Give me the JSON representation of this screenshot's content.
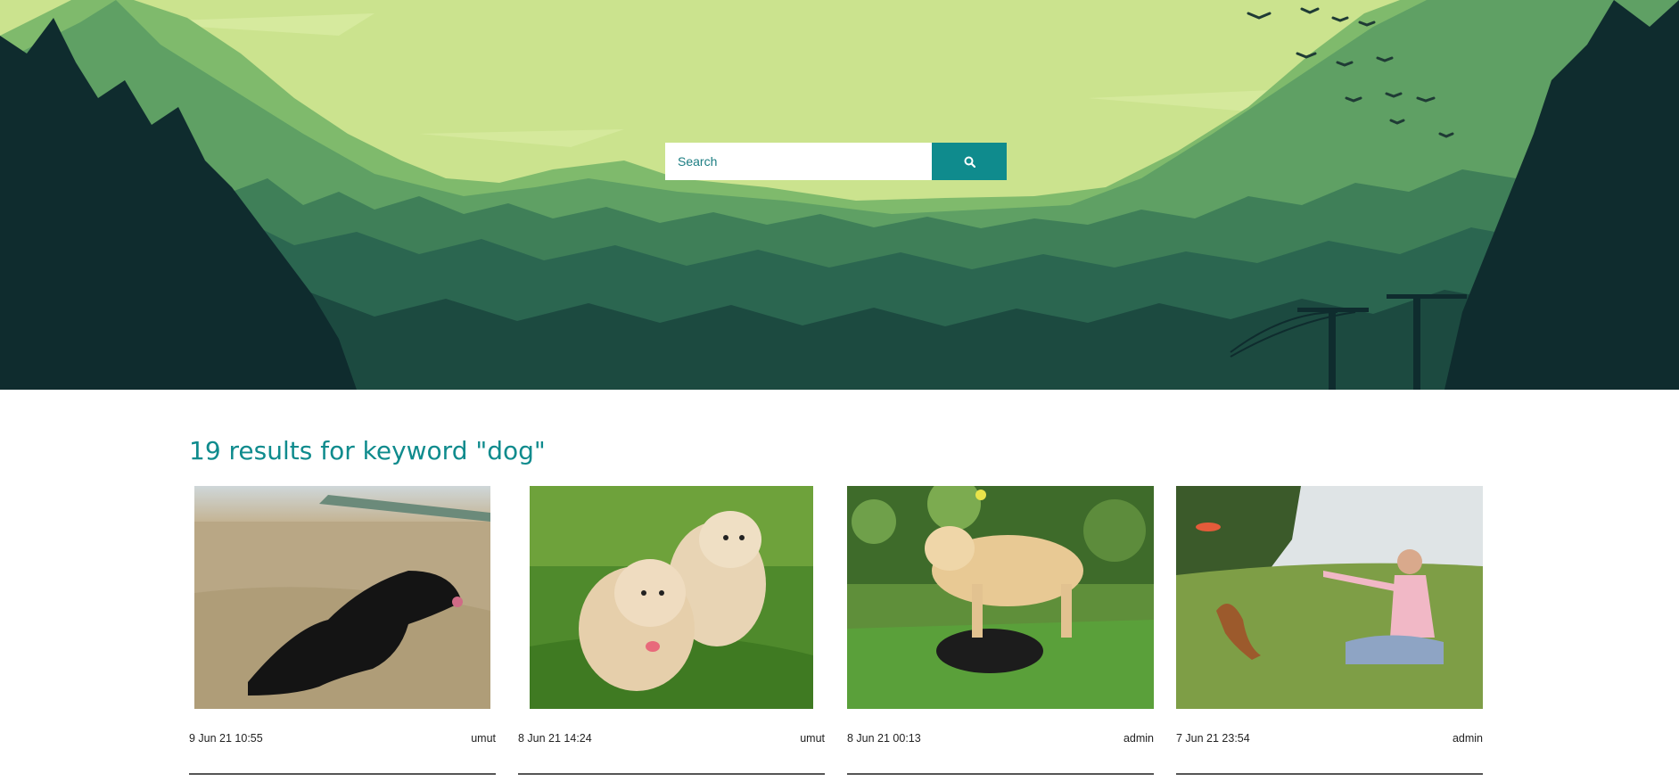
{
  "search": {
    "placeholder": "Search",
    "icon": "search-icon"
  },
  "results": {
    "heading": "19 results for keyword \"dog\"",
    "cards": [
      {
        "date": "9 Jun 21 10:55",
        "author": "umut",
        "image": "black-dog-running-field"
      },
      {
        "date": "8 Jun 21 14:24",
        "author": "umut",
        "image": "two-terriers-running-grass"
      },
      {
        "date": "8 Jun 21 00:13",
        "author": "admin",
        "image": "golden-retriever-playing-rottweiler"
      },
      {
        "date": "7 Jun 21 23:54",
        "author": "admin",
        "image": "woman-throwing-frisbee-dog"
      }
    ]
  },
  "colors": {
    "accent": "#0f8b8d",
    "sky": "#cbe38e",
    "forest_dark": "#0f2c2e"
  }
}
